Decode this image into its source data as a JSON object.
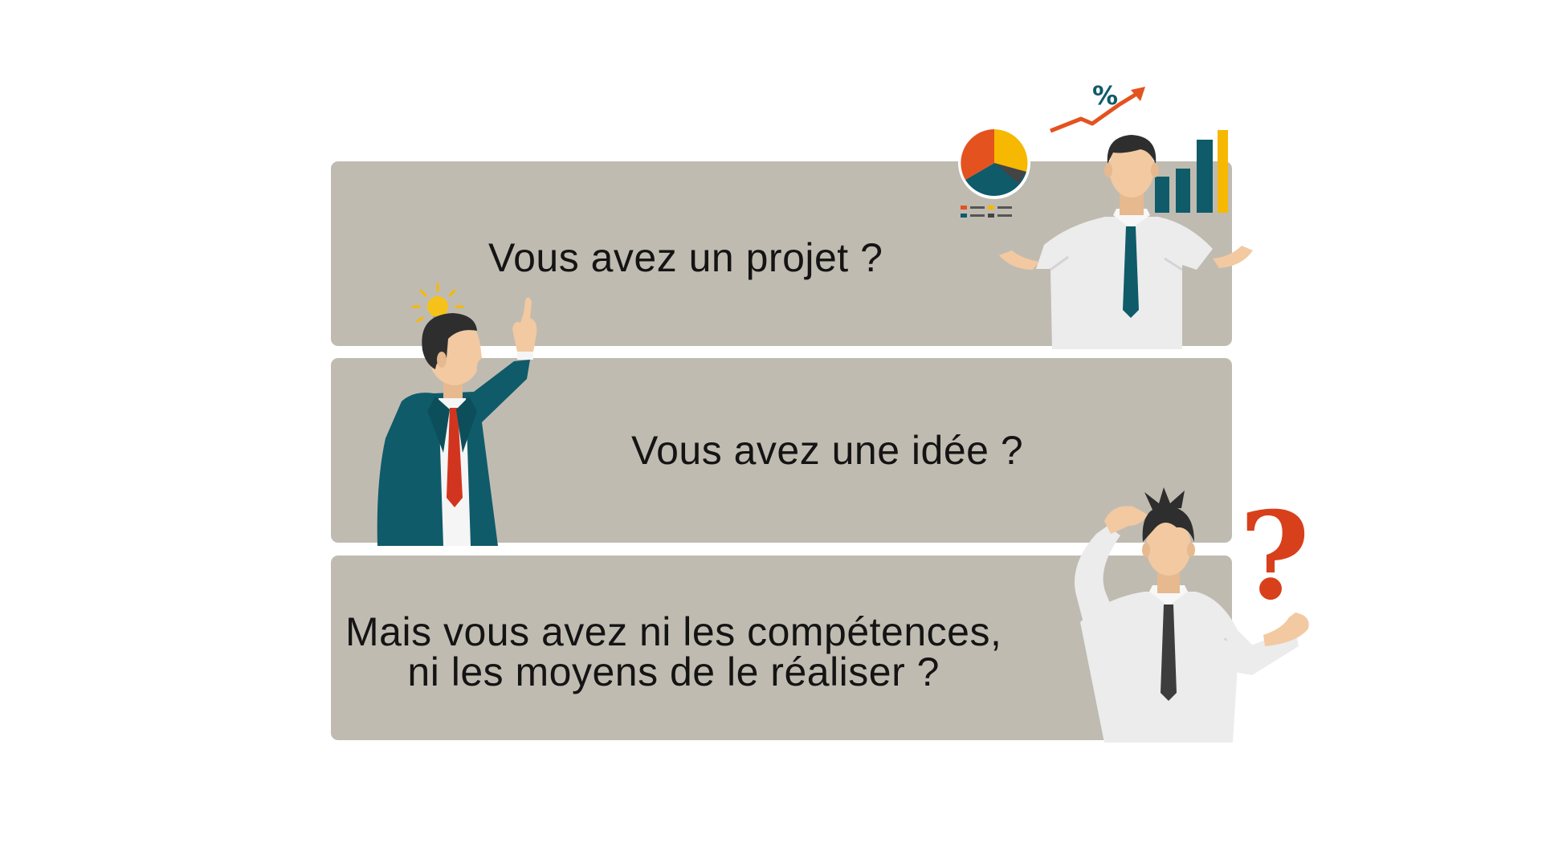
{
  "panels": {
    "line1": "Vous avez un projet ?",
    "line2": "Vous avez une idée ?",
    "line3_a": "Mais vous avez ni les compétences,",
    "line3_b": "ni les moyens de le réaliser ?"
  },
  "decorations": {
    "percent_symbol": "%",
    "question_mark": "?"
  },
  "icons": [
    "pie-chart-icon",
    "bar-chart-icon",
    "trend-arrow-icon",
    "lightbulb-icon",
    "question-mark-icon"
  ],
  "colors": {
    "panel": "#c0bbb1",
    "text": "#141414",
    "teal": "#0f5b6a",
    "orange": "#e4521f",
    "yellow": "#f6b800",
    "red_tie": "#d2351f",
    "shirt": "#ececec",
    "skin": "#f2c9a1",
    "hair": "#2e2e2e"
  }
}
